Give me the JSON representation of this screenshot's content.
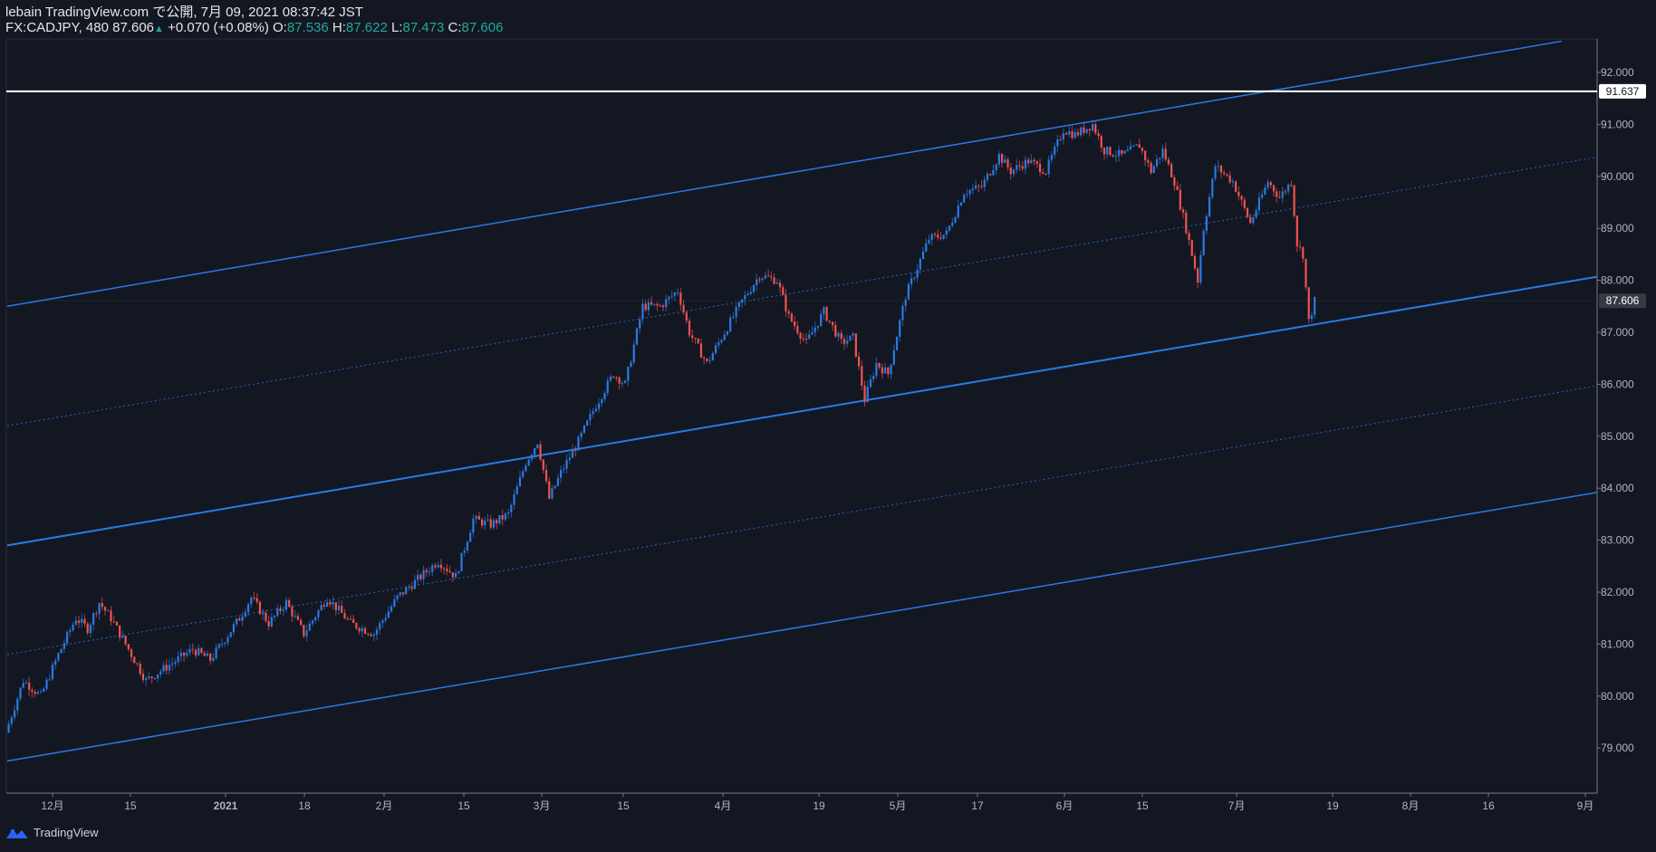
{
  "header": {
    "publish_line": "lebain TradingView.com で公開, 7月 09, 2021 08:37:42 JST",
    "symbol": "FX:CADJPY, 480",
    "last": "87.606",
    "change": "+0.070 (+0.08%)",
    "o_label": "O:",
    "o_value": "87.536",
    "h_label": "H:",
    "h_value": "87.622",
    "l_label": "L:",
    "l_value": "87.473",
    "c_label": "C:",
    "c_value": "87.606"
  },
  "footer": {
    "brand": "TradingView",
    "logo_icon": "tradingview-logo-icon"
  },
  "colors": {
    "background": "#131722",
    "up": "#2a7ae2",
    "down": "#ef5350",
    "channel": "#2a7ae2",
    "resistance": "#ffffff",
    "axis_text": "#b2b5be"
  },
  "chart_data": {
    "type": "candlestick",
    "symbol": "CADJPY",
    "timeframe": "480",
    "y_axis": {
      "ticks": [
        "92.000",
        "91.000",
        "90.000",
        "89.000",
        "88.000",
        "87.000",
        "86.000",
        "85.000",
        "84.000",
        "83.000",
        "82.000",
        "81.000",
        "80.000",
        "79.000"
      ],
      "ylim": [
        78.2,
        92.6
      ]
    },
    "x_axis": {
      "ticks": [
        "12月",
        "15",
        "2021",
        "18",
        "2月",
        "15",
        "3月",
        "15",
        "4月",
        "19",
        "5月",
        "17",
        "6月",
        "15",
        "7月",
        "19",
        "8月",
        "16",
        "9月"
      ]
    },
    "price_labels": [
      {
        "value": "91.637",
        "style": "resistance"
      },
      {
        "value": "87.606",
        "style": "last"
      }
    ],
    "horizontal_line": 91.637,
    "last_price": 87.606,
    "channel": {
      "upper": [
        {
          "x": "2020-11-27",
          "y": 87.5
        },
        {
          "x": "2021-08-20",
          "y": 92.6
        }
      ],
      "upper_mid": [
        {
          "x": "2020-11-27",
          "y": 85.2
        },
        {
          "x": "2021-09-02",
          "y": 90.5
        }
      ],
      "middle": [
        {
          "x": "2020-11-27",
          "y": 82.9
        },
        {
          "x": "2021-09-02",
          "y": 88.2
        }
      ],
      "lower_mid": [
        {
          "x": "2020-11-27",
          "y": 80.8
        },
        {
          "x": "2021-09-02",
          "y": 86.1
        }
      ],
      "lower": [
        {
          "x": "2020-11-27",
          "y": 78.75
        },
        {
          "x": "2021-09-02",
          "y": 84.05
        }
      ]
    },
    "series_path": [
      {
        "x": "2020-11-27",
        "y": 79.3
      },
      {
        "x": "2020-11-30",
        "y": 80.3
      },
      {
        "x": "2020-12-03",
        "y": 80.0
      },
      {
        "x": "2020-12-06",
        "y": 80.8
      },
      {
        "x": "2020-12-09",
        "y": 81.5
      },
      {
        "x": "2020-12-11",
        "y": 81.3
      },
      {
        "x": "2020-12-13",
        "y": 81.8
      },
      {
        "x": "2020-12-15",
        "y": 81.5
      },
      {
        "x": "2020-12-17",
        "y": 81.1
      },
      {
        "x": "2020-12-21",
        "y": 80.3
      },
      {
        "x": "2020-12-25",
        "y": 80.6
      },
      {
        "x": "2020-12-29",
        "y": 80.9
      },
      {
        "x": "2021-01-01",
        "y": 80.7
      },
      {
        "x": "2021-01-06",
        "y": 81.5
      },
      {
        "x": "2021-01-08",
        "y": 81.9
      },
      {
        "x": "2021-01-11",
        "y": 81.4
      },
      {
        "x": "2021-01-14",
        "y": 81.8
      },
      {
        "x": "2021-01-17",
        "y": 81.2
      },
      {
        "x": "2021-01-21",
        "y": 81.9
      },
      {
        "x": "2021-01-25",
        "y": 81.4
      },
      {
        "x": "2021-01-29",
        "y": 81.2
      },
      {
        "x": "2021-02-02",
        "y": 81.9
      },
      {
        "x": "2021-02-06",
        "y": 82.3
      },
      {
        "x": "2021-02-09",
        "y": 82.6
      },
      {
        "x": "2021-02-12",
        "y": 82.3
      },
      {
        "x": "2021-02-15",
        "y": 83.4
      },
      {
        "x": "2021-02-18",
        "y": 83.3
      },
      {
        "x": "2021-02-21",
        "y": 83.5
      },
      {
        "x": "2021-02-24",
        "y": 84.5
      },
      {
        "x": "2021-02-26",
        "y": 84.9
      },
      {
        "x": "2021-02-28",
        "y": 83.8
      },
      {
        "x": "2021-03-02",
        "y": 84.3
      },
      {
        "x": "2021-03-05",
        "y": 84.9
      },
      {
        "x": "2021-03-08",
        "y": 85.6
      },
      {
        "x": "2021-03-11",
        "y": 86.2
      },
      {
        "x": "2021-03-13",
        "y": 86.0
      },
      {
        "x": "2021-03-16",
        "y": 87.5
      },
      {
        "x": "2021-03-19",
        "y": 87.5
      },
      {
        "x": "2021-03-22",
        "y": 87.8
      },
      {
        "x": "2021-03-24",
        "y": 87.0
      },
      {
        "x": "2021-03-27",
        "y": 86.4
      },
      {
        "x": "2021-03-30",
        "y": 87.0
      },
      {
        "x": "2021-04-02",
        "y": 87.6
      },
      {
        "x": "2021-04-05",
        "y": 88.1
      },
      {
        "x": "2021-04-08",
        "y": 88.0
      },
      {
        "x": "2021-04-10",
        "y": 87.3
      },
      {
        "x": "2021-04-13",
        "y": 86.8
      },
      {
        "x": "2021-04-16",
        "y": 87.4
      },
      {
        "x": "2021-04-19",
        "y": 86.8
      },
      {
        "x": "2021-04-21",
        "y": 86.9
      },
      {
        "x": "2021-04-23",
        "y": 85.7
      },
      {
        "x": "2021-04-25",
        "y": 86.4
      },
      {
        "x": "2021-04-27",
        "y": 86.2
      },
      {
        "x": "2021-04-30",
        "y": 87.7
      },
      {
        "x": "2021-05-04",
        "y": 88.8
      },
      {
        "x": "2021-05-07",
        "y": 88.9
      },
      {
        "x": "2021-05-10",
        "y": 89.7
      },
      {
        "x": "2021-05-13",
        "y": 89.8
      },
      {
        "x": "2021-05-16",
        "y": 90.4
      },
      {
        "x": "2021-05-18",
        "y": 90.1
      },
      {
        "x": "2021-05-21",
        "y": 90.3
      },
      {
        "x": "2021-05-24",
        "y": 90.1
      },
      {
        "x": "2021-05-27",
        "y": 90.9
      },
      {
        "x": "2021-05-29",
        "y": 90.8
      },
      {
        "x": "2021-06-01",
        "y": 91.0
      },
      {
        "x": "2021-06-03",
        "y": 90.5
      },
      {
        "x": "2021-06-06",
        "y": 90.4
      },
      {
        "x": "2021-06-09",
        "y": 90.6
      },
      {
        "x": "2021-06-11",
        "y": 90.1
      },
      {
        "x": "2021-06-13",
        "y": 90.5
      },
      {
        "x": "2021-06-15",
        "y": 89.9
      },
      {
        "x": "2021-06-17",
        "y": 89.0
      },
      {
        "x": "2021-06-19",
        "y": 88.0
      },
      {
        "x": "2021-06-20",
        "y": 89.0
      },
      {
        "x": "2021-06-22",
        "y": 90.2
      },
      {
        "x": "2021-06-25",
        "y": 89.9
      },
      {
        "x": "2021-06-28",
        "y": 89.1
      },
      {
        "x": "2021-07-01",
        "y": 89.9
      },
      {
        "x": "2021-07-03",
        "y": 89.6
      },
      {
        "x": "2021-07-05",
        "y": 89.9
      },
      {
        "x": "2021-07-06",
        "y": 88.7
      },
      {
        "x": "2021-07-07",
        "y": 88.5
      },
      {
        "x": "2021-07-08",
        "y": 87.2
      },
      {
        "x": "2021-07-09",
        "y": 87.6
      }
    ]
  }
}
